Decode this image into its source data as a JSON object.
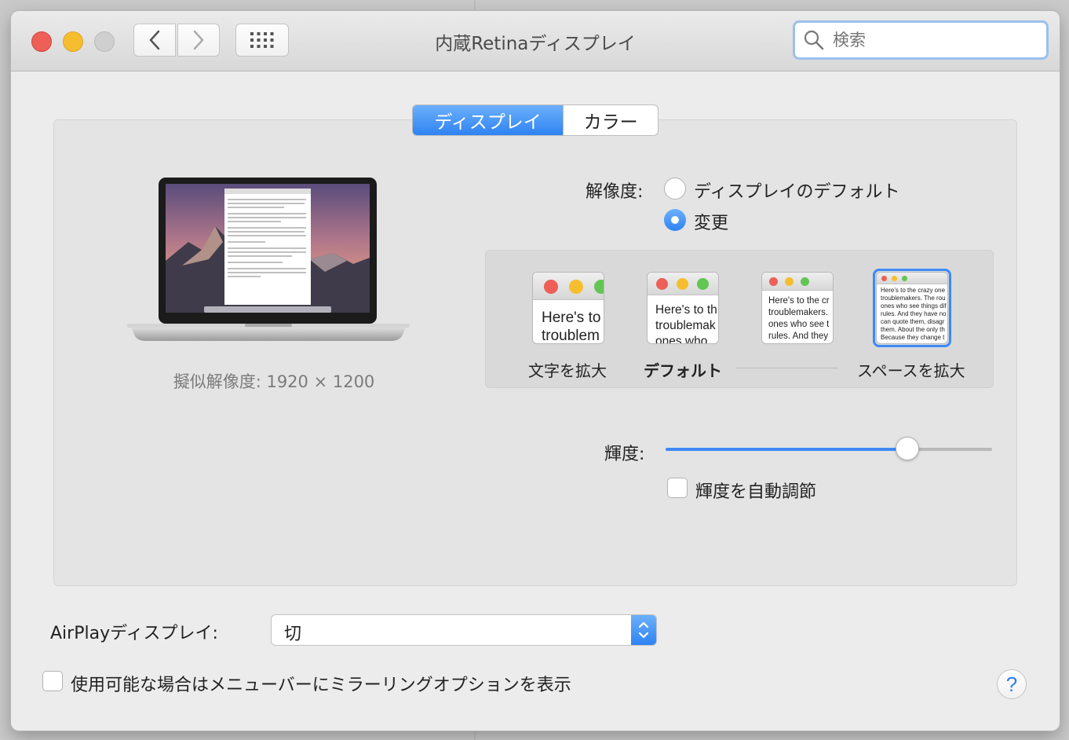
{
  "window": {
    "title": "内蔵Retinaディスプレイ",
    "search_placeholder": "検索"
  },
  "tabs": [
    {
      "label": "ディスプレイ",
      "selected": true
    },
    {
      "label": "カラー",
      "selected": false
    }
  ],
  "display": {
    "simulated_resolution": "擬似解像度: 1920 × 1200",
    "resolution_label": "解像度:",
    "options": [
      {
        "label": "ディスプレイのデフォルト",
        "selected": false
      },
      {
        "label": "変更",
        "selected": true
      }
    ],
    "scaled": {
      "thumbnails": [
        {
          "text": "Here's to troublem",
          "selected": false
        },
        {
          "text": "Here's to th troublemak ones who",
          "selected": false
        },
        {
          "text": "Here's to the cr troublemakers. ones who see t rules. And they",
          "selected": false
        },
        {
          "text": "Here's to the crazy one troublemakers. The rou ones who see things dif rules. And they have no can quote them, disagr them. About the only th Because they change t",
          "selected": true
        }
      ],
      "labels": [
        "文字を拡大",
        "デフォルト",
        "スペースを拡大"
      ]
    },
    "brightness_label": "輝度:",
    "brightness_level": 0.74,
    "auto_brightness_label": "輝度を自動調節",
    "auto_brightness_checked": false
  },
  "airplay": {
    "label": "AirPlayディスプレイ:",
    "value": "切"
  },
  "mirroring_option": {
    "label": "使用可能な場合はメニューバーにミラーリングオプションを表示",
    "checked": false
  },
  "help_label": "?",
  "colors": {
    "accent": "#3d8af7",
    "close": "#ed5f57",
    "minimize": "#f6be2f",
    "zoom": "#cfcfcf"
  }
}
